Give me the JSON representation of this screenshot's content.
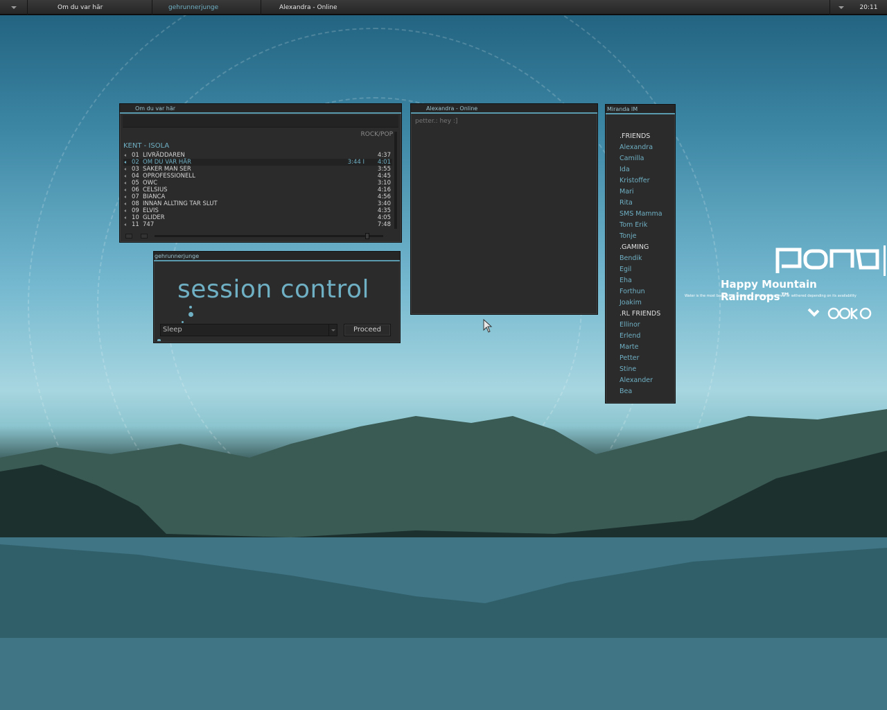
{
  "taskbar": {
    "items": [
      {
        "label": "Om du var här"
      },
      {
        "label": "gehrunnerjunge"
      },
      {
        "label": "Alexandra - Online"
      }
    ],
    "clock": "20:11"
  },
  "player": {
    "title": "Om du var här",
    "genre": "ROCK/POP",
    "album": "KENT - ISOLA",
    "tracks": [
      {
        "num": "01",
        "title": "LIVRÄDDAREN",
        "duration": "4:37"
      },
      {
        "num": "02",
        "title": "OM DU VAR HÄR",
        "duration": "4:01",
        "elapsed": "3:44   I"
      },
      {
        "num": "03",
        "title": "SAKER MAN SER",
        "duration": "3:55"
      },
      {
        "num": "04",
        "title": "OPROFESSIONELL",
        "duration": "4:45"
      },
      {
        "num": "05",
        "title": "OWC",
        "duration": "3:10"
      },
      {
        "num": "06",
        "title": "CELSIUS",
        "duration": "4:16"
      },
      {
        "num": "07",
        "title": "BIANCA",
        "duration": "4:56"
      },
      {
        "num": "08",
        "title": "INNAN ALLTING TAR SLUT",
        "duration": "3:40"
      },
      {
        "num": "09",
        "title": "ELVIS",
        "duration": "4:35"
      },
      {
        "num": "10",
        "title": "GLIDER",
        "duration": "4:05"
      },
      {
        "num": "11",
        "title": "747",
        "duration": "7:48"
      }
    ],
    "active_track": "02",
    "seek_progress": 0.93
  },
  "session": {
    "title": "gehrunnerjunge",
    "heading": "session control",
    "selected_action": "Sleep",
    "proceed_label": "Proceed"
  },
  "chat": {
    "title": "Alexandra - Online",
    "message": "petter.: hey :]"
  },
  "contacts": {
    "title": "Miranda IM",
    "entries": [
      {
        "label": ".FRIENDS",
        "group": true
      },
      {
        "label": "Alexandra"
      },
      {
        "label": "Camilla"
      },
      {
        "label": "Ida"
      },
      {
        "label": "Kristoffer"
      },
      {
        "label": "Mari"
      },
      {
        "label": "Rita"
      },
      {
        "label": "SMS Mamma"
      },
      {
        "label": "Tom Erik"
      },
      {
        "label": "Tonje"
      },
      {
        "label": ".GAMING",
        "group": true
      },
      {
        "label": "Bendik"
      },
      {
        "label": "Egil"
      },
      {
        "label": "Eha"
      },
      {
        "label": "Forthun"
      },
      {
        "label": "Joakim"
      },
      {
        "label": ".RL FRIENDS",
        "group": true
      },
      {
        "label": "Ellinor"
      },
      {
        "label": "Erlend"
      },
      {
        "label": "Marte"
      },
      {
        "label": "Petter"
      },
      {
        "label": "Stine"
      },
      {
        "label": "Alexander"
      },
      {
        "label": "Bea"
      }
    ]
  },
  "wallpaper": {
    "brand": "pond",
    "headline": "Happy Mountain Raindrops™",
    "tagline": "Water is the most basic of all resources. Civilizations grew or withered depending on its availability",
    "maker": "aoiko"
  },
  "colors": {
    "accent": "#6fb0c4",
    "window_bg": "#2b2b2b",
    "taskbar_bg": "#2a2a2a"
  }
}
